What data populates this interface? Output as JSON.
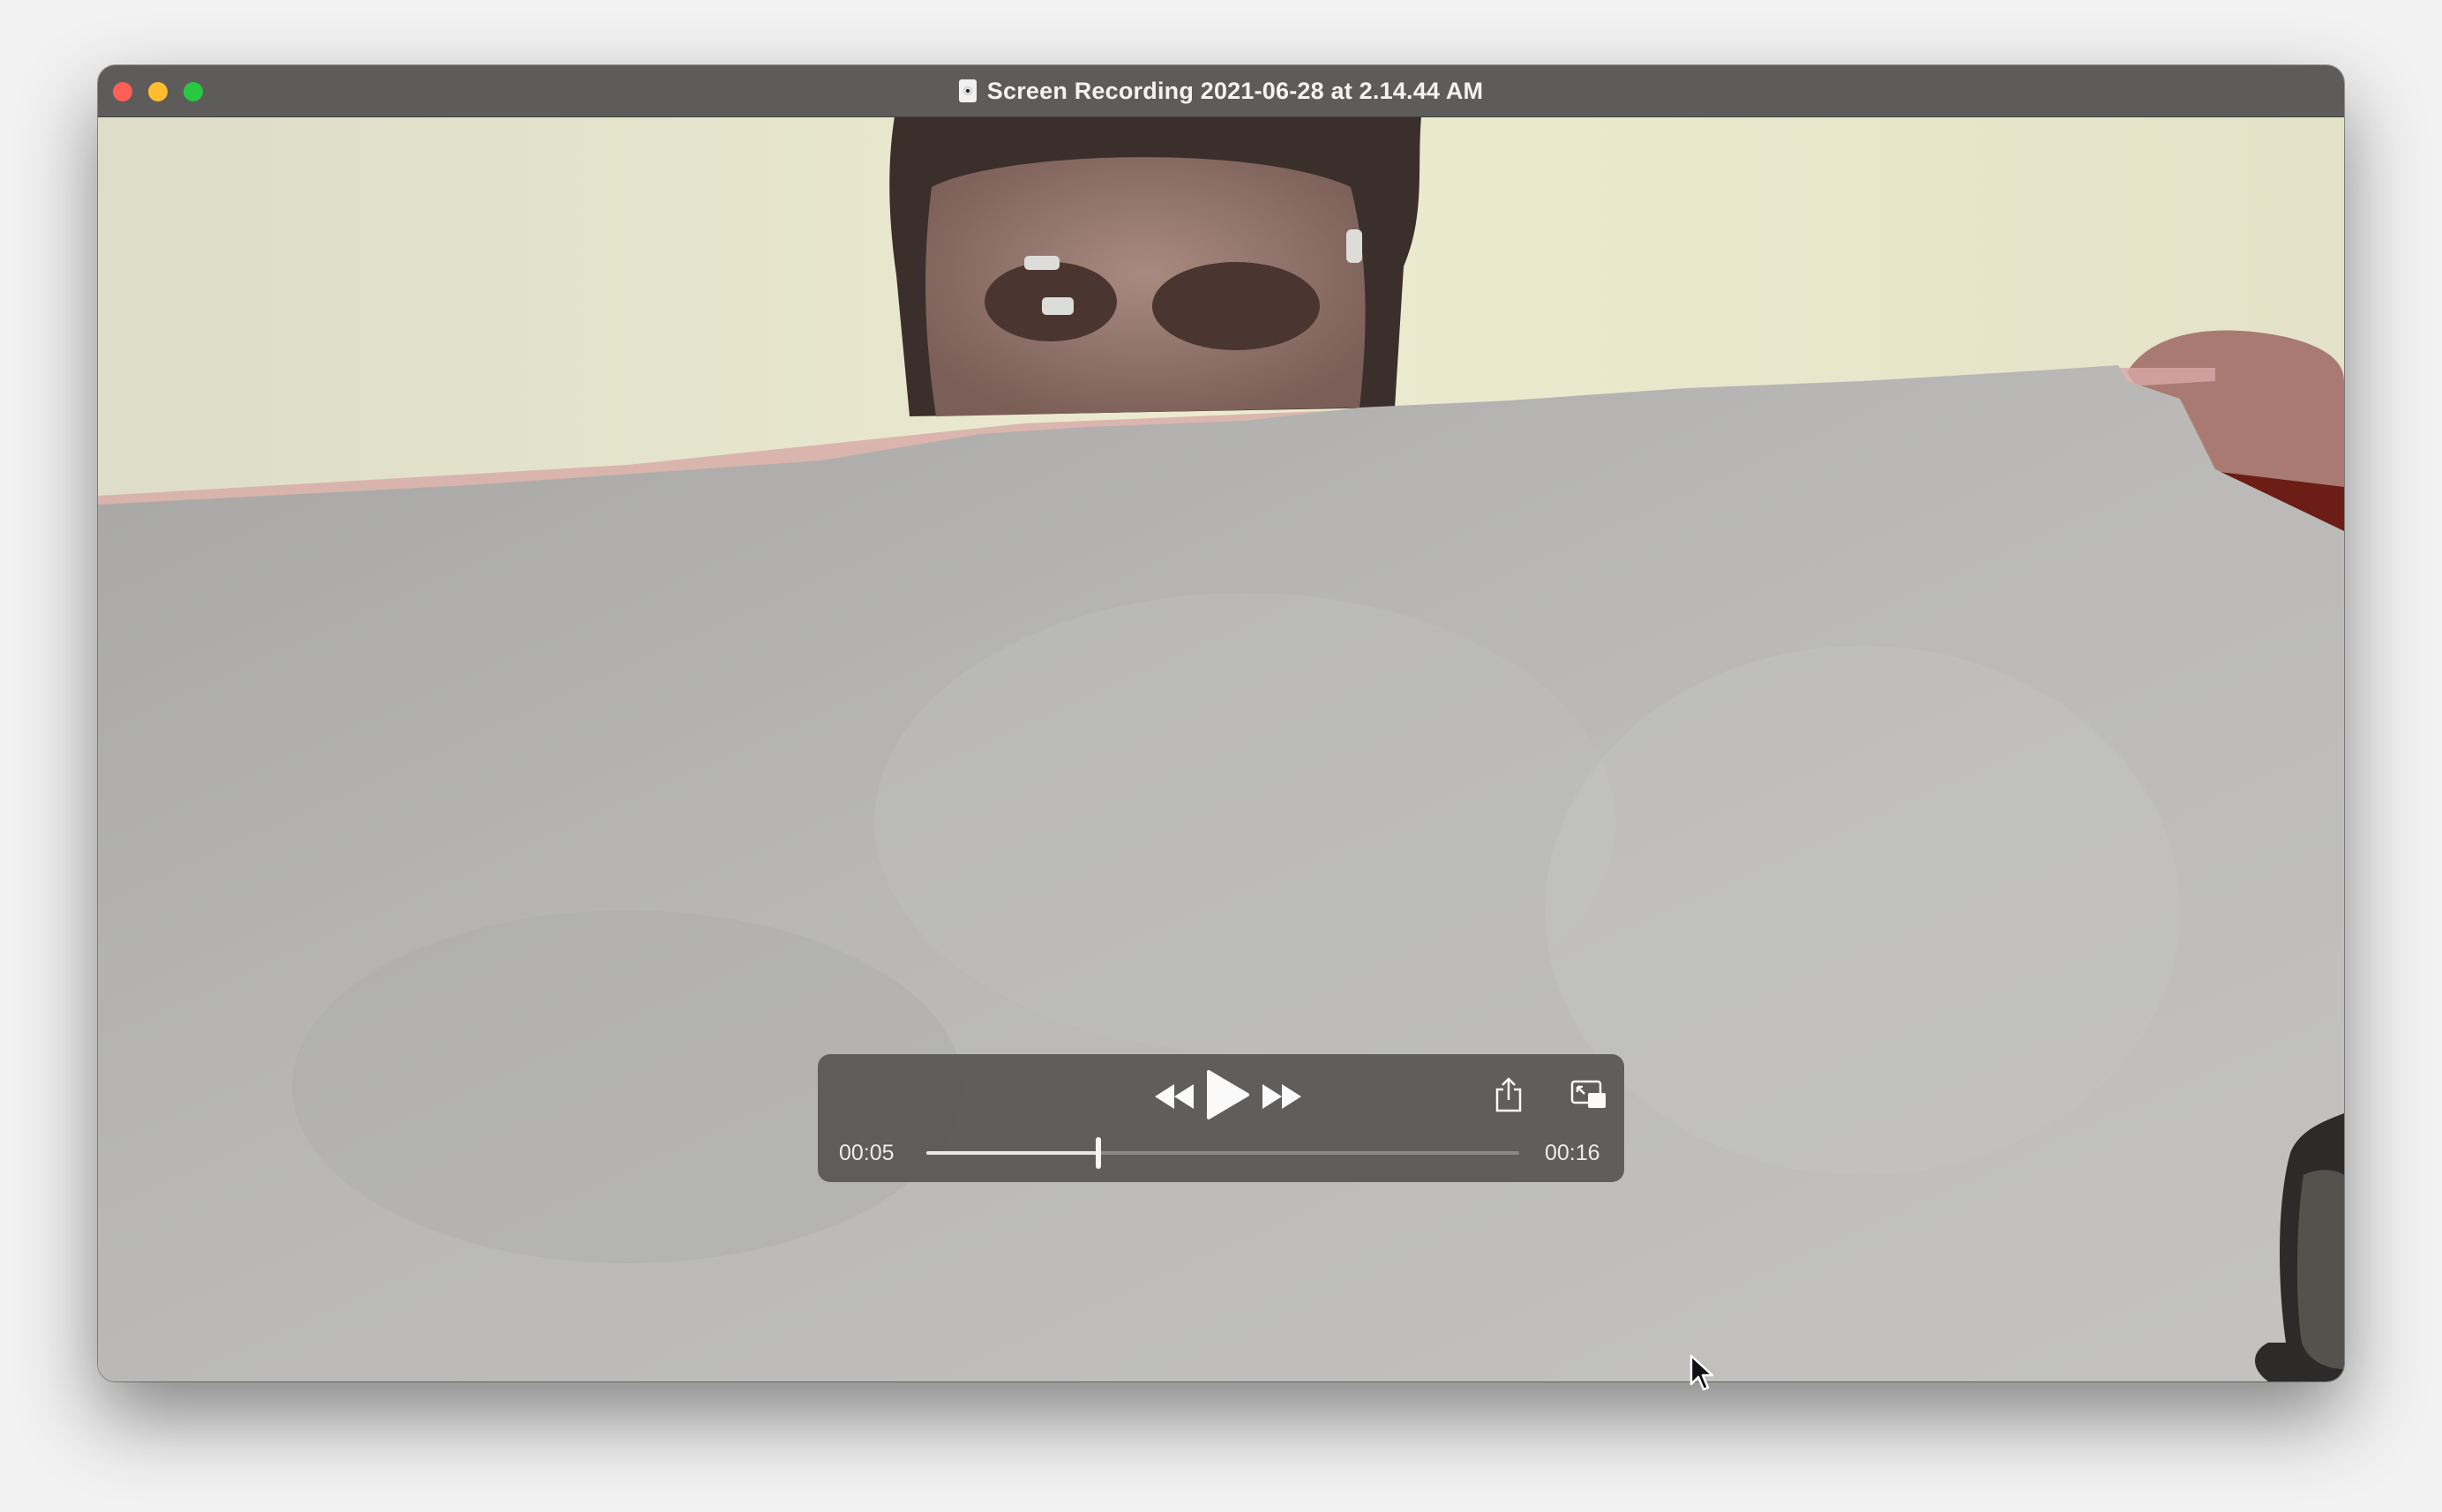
{
  "window": {
    "title": "Screen Recording 2021-06-28 at 2.14.44 AM"
  },
  "player": {
    "current_time": "00:05",
    "total_time": "00:16",
    "progress": 0.29,
    "icons": {
      "rewind": "rewind-icon",
      "play": "play-icon",
      "fast_forward": "fast-forward-icon",
      "share": "share-icon",
      "pip": "picture-in-picture-icon"
    }
  },
  "colors": {
    "titlebar": "#5d5c5b",
    "hud": "#585654",
    "close": "#ff5f57",
    "minimize": "#febc2e",
    "maximize": "#28c840"
  }
}
